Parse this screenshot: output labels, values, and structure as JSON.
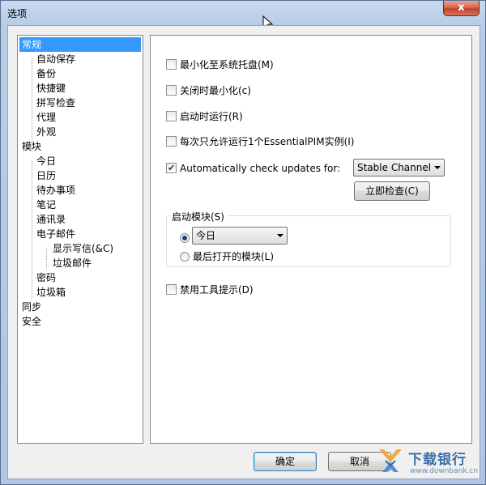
{
  "window": {
    "title": "选项",
    "close_label": "x"
  },
  "tree": {
    "items": [
      {
        "label": "常规",
        "selected": true
      },
      {
        "label": "自动保存"
      },
      {
        "label": "备份"
      },
      {
        "label": "快捷键"
      },
      {
        "label": "拼写检查"
      },
      {
        "label": "代理"
      },
      {
        "label": "外观"
      },
      {
        "label": "模块"
      },
      {
        "label": "今日"
      },
      {
        "label": "日历"
      },
      {
        "label": "待办事项"
      },
      {
        "label": "笔记"
      },
      {
        "label": "通讯录"
      },
      {
        "label": "电子邮件"
      },
      {
        "label": "显示写信(&C)"
      },
      {
        "label": "垃圾邮件"
      },
      {
        "label": "密码"
      },
      {
        "label": "垃圾箱"
      },
      {
        "label": "同步"
      },
      {
        "label": "安全"
      }
    ]
  },
  "general": {
    "minimize_to_tray": {
      "label": "最小化至系统托盘(M)",
      "checked": false
    },
    "minimize_on_close": {
      "label": "关闭时最小化(c)",
      "checked": false
    },
    "run_on_startup": {
      "label": "启动时运行(R)",
      "checked": false
    },
    "single_instance": {
      "label": "每次只允许运行1个EssentialPIM实例(I)",
      "checked": false
    },
    "auto_check_updates": {
      "label": "Automatically check updates for:",
      "checked": true
    },
    "update_channel": "Stable Channel",
    "check_now_button": "立即检查(C)",
    "startup_module_group": "启动模块(S)",
    "startup_module_option": "今日",
    "last_opened_module": "最后打开的模块(L)",
    "disable_tooltips": {
      "label": "禁用工具提示(D)",
      "checked": false
    }
  },
  "footer": {
    "ok_button": "确定",
    "cancel_button": "取消"
  },
  "watermark": {
    "name": "下载银行",
    "url": "www.downbank.cn"
  },
  "colors": {
    "selection": "#3399ff",
    "frame": "#b9cde7"
  }
}
